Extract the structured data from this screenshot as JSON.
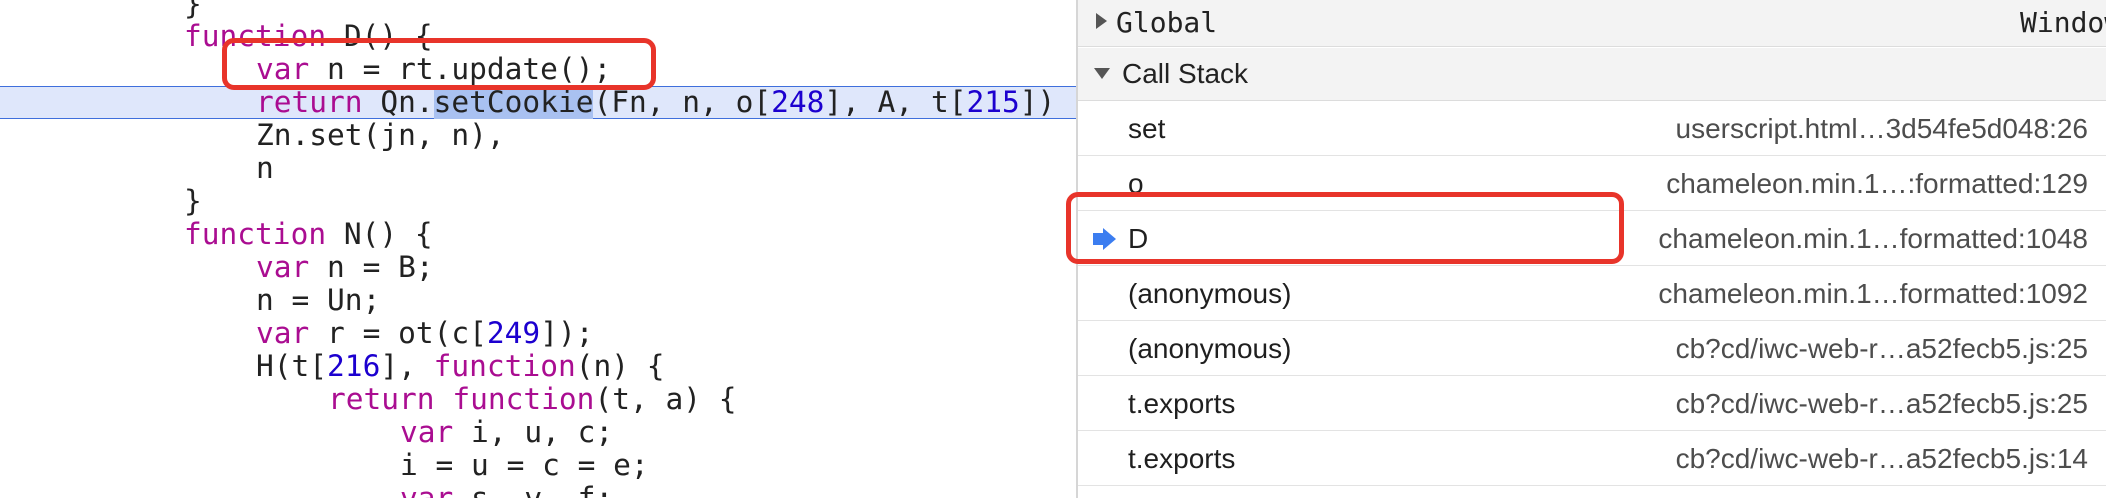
{
  "code": {
    "closing_brace_top": "}",
    "line1_kw": "function",
    "line1_rest": " D() {",
    "line2_kw": "var",
    "line2_rest": " n = rt.update();",
    "line3_kw": "return",
    "line3_pre": " Qn.",
    "line3_sel": "setCookie",
    "line3_a": "(Fn, n, o[",
    "line3_n1": "248",
    "line3_b": "], A, t[",
    "line3_n2": "215",
    "line3_c": "])",
    "line4": "Zn.set(jn, n),",
    "line5": "n",
    "line6": "}",
    "line7_kw": "function",
    "line7_rest": " N() {",
    "line8_kw": "var",
    "line8_rest": " n = B;",
    "line9": "n = Un;",
    "line10_kw": "var",
    "line10_a": " r = ot(c[",
    "line10_n": "249",
    "line10_b": "]);",
    "line11_a": "H(t[",
    "line11_n": "216",
    "line11_b": "], ",
    "line11_kw": "function",
    "line11_c": "(n) {",
    "line12_kw1": "return",
    "line12_sp": " ",
    "line12_kw2": "function",
    "line12_c": "(t, a) {",
    "line13_kw": "var",
    "line13_rest": " i, u, c;",
    "line14": "i = u = c = e;",
    "line15_kw": "var",
    "line15_rest": " s, v, f;"
  },
  "scope": {
    "global_label": "Global",
    "global_value": "Window"
  },
  "call_stack": {
    "title": "Call Stack",
    "frames": [
      {
        "name": "set",
        "location": "userscript.html…3d54fe5d048:26"
      },
      {
        "name": "o",
        "location": "chameleon.min.1…:formatted:129"
      },
      {
        "name": "D",
        "location": "chameleon.min.1…formatted:1048"
      },
      {
        "name": "(anonymous)",
        "location": "chameleon.min.1…formatted:1092"
      },
      {
        "name": "(anonymous)",
        "location": "cb?cd/iwc-web-r…a52fecb5.js:25"
      },
      {
        "name": "t.exports",
        "location": "cb?cd/iwc-web-r…a52fecb5.js:25"
      },
      {
        "name": "t.exports",
        "location": "cb?cd/iwc-web-r…a52fecb5.js:14"
      }
    ]
  },
  "colors": {
    "keyword": "#aa0d91",
    "number": "#1c00cf",
    "highlight_border": "#3f6fdc",
    "annotation_red": "#e8342a",
    "current_frame_arrow": "#3b7df0"
  }
}
